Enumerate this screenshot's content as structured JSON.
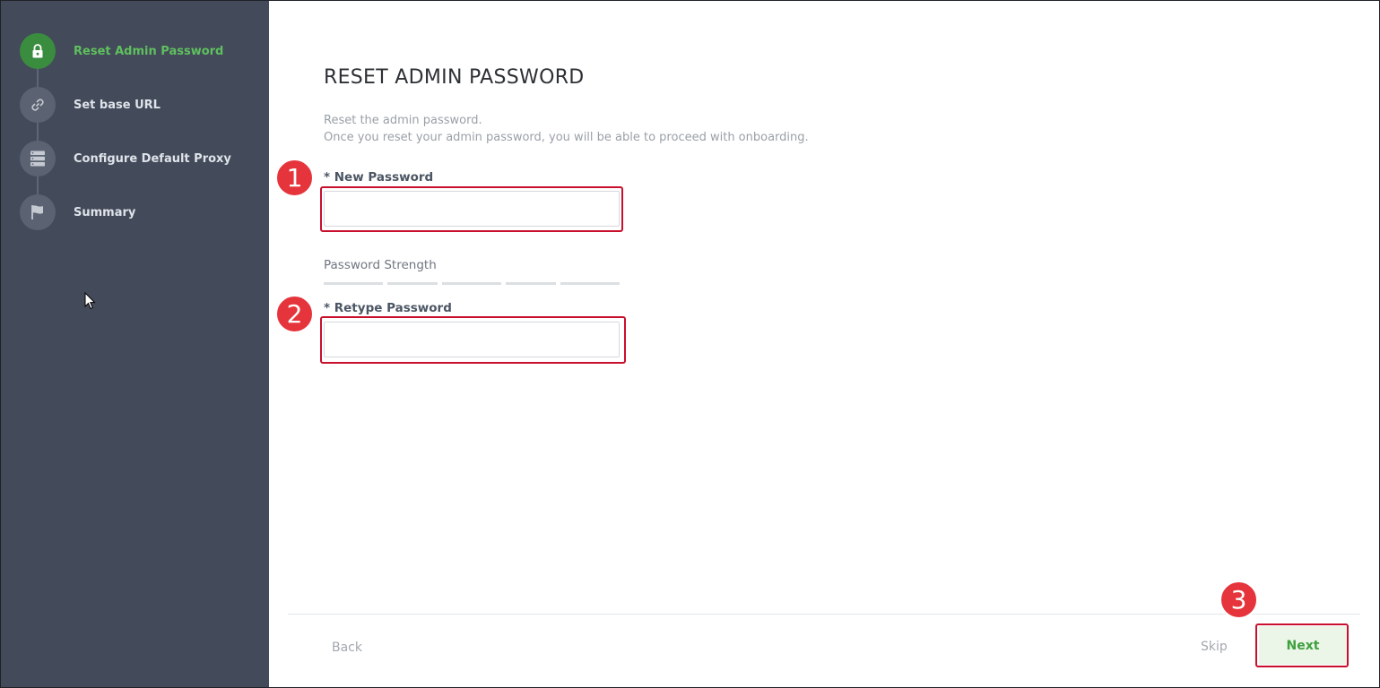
{
  "wizard": {
    "steps": [
      {
        "label": "Reset Admin Password",
        "icon": "lock-icon",
        "active": true
      },
      {
        "label": "Set base URL",
        "icon": "link-icon",
        "active": false
      },
      {
        "label": "Configure Default Proxy",
        "icon": "server-stack-icon",
        "active": false
      },
      {
        "label": "Summary",
        "icon": "flag-icon",
        "active": false
      }
    ]
  },
  "main": {
    "title": "RESET ADMIN PASSWORD",
    "description_line1": "Reset the admin password.",
    "description_line2": "Once you reset your admin password, you will be able to proceed with onboarding.",
    "new_password": {
      "label": "* New Password",
      "value": "",
      "placeholder": ""
    },
    "password_strength": {
      "label": "Password Strength",
      "level": 0,
      "segments": 5
    },
    "retype_password": {
      "label": "* Retype Password",
      "value": "",
      "placeholder": ""
    }
  },
  "footer": {
    "back_label": "Back",
    "skip_label": "Skip",
    "next_label": "Next"
  },
  "annotations": {
    "badge1": "1",
    "badge2": "2",
    "badge3": "3"
  },
  "colors": {
    "sidebar_bg": "#434a59",
    "active_green": "#5fc05f",
    "highlight_red": "#c8102e",
    "badge_red": "#e5343b"
  }
}
